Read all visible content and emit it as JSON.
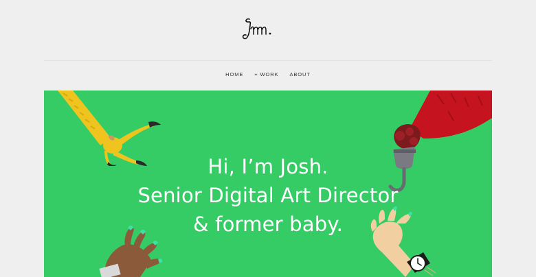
{
  "header": {
    "logo_signature": "Jm."
  },
  "nav": {
    "items": [
      {
        "label": "HOME"
      },
      {
        "label": "+ WORK"
      },
      {
        "label": "ABOUT"
      }
    ]
  },
  "hero": {
    "background_color": "#35cc66",
    "lines": [
      "Hi, I’m Josh.",
      "Senior Digital Art Director",
      "& former baby."
    ],
    "illustrations": [
      "bird-claw",
      "hook-hand",
      "brown-hand",
      "wristwatch-hand"
    ]
  }
}
